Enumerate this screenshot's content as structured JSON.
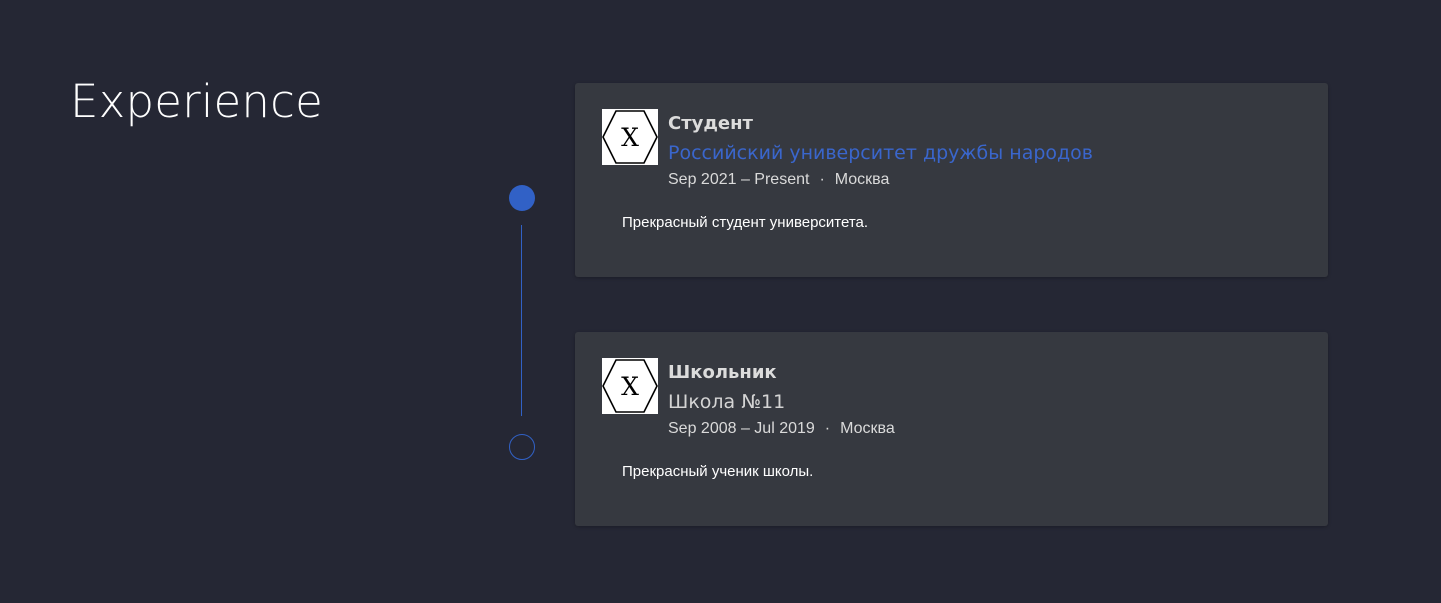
{
  "section": {
    "title": "Experience"
  },
  "colors": {
    "background": "#252734",
    "card": "#363940",
    "accent": "#3161c6",
    "link": "#3a66cc"
  },
  "experience": [
    {
      "logo_icon": "hexagon-x-logo-icon",
      "logo_text": "X",
      "role": "Студент",
      "organization": "Российский университет дружбы народов",
      "organization_is_link": true,
      "dates": "Sep 2021 – Present",
      "separator": "·",
      "location": "Москва",
      "description": "Прекрасный студент университета."
    },
    {
      "logo_icon": "hexagon-x-logo-icon",
      "logo_text": "X",
      "role": "Школьник",
      "organization": "Школа №11",
      "organization_is_link": false,
      "dates": "Sep 2008 – Jul 2019",
      "separator": "·",
      "location": "Москва",
      "description": "Прекрасный ученик школы."
    }
  ]
}
